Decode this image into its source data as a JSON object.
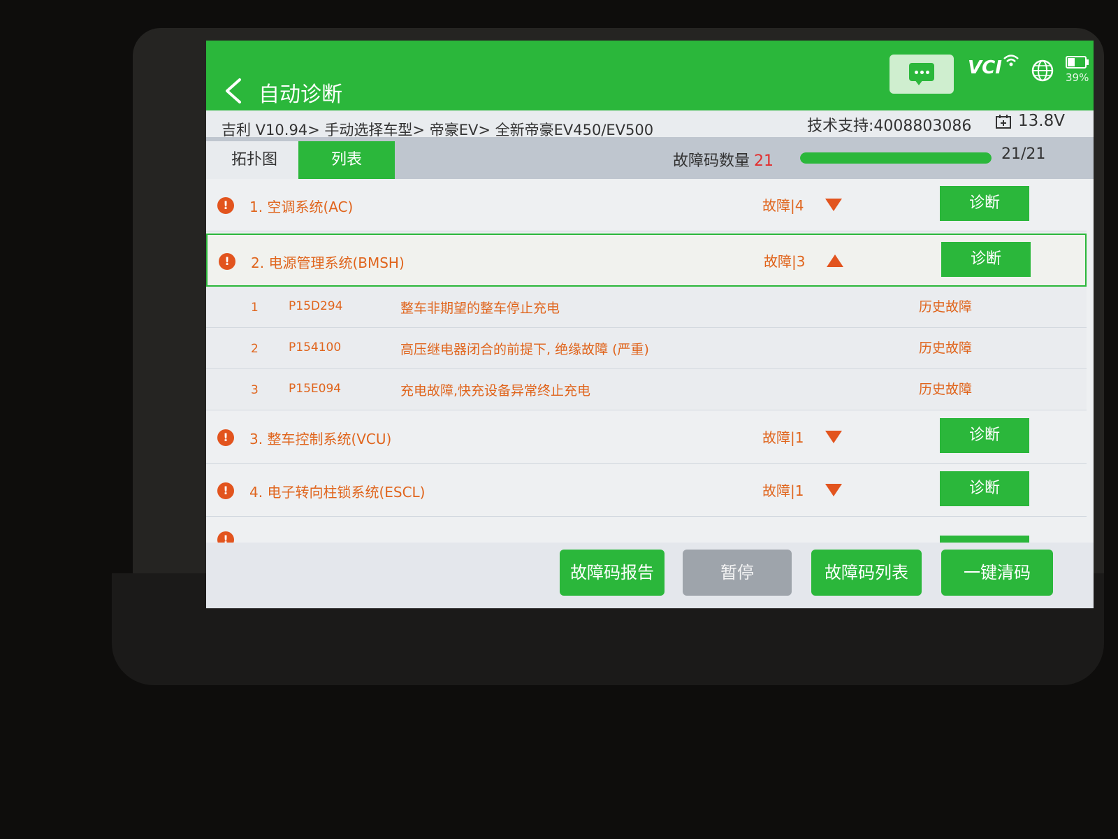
{
  "header": {
    "title": "自动诊断",
    "vci": "VCI",
    "battery": "39%",
    "colors": {
      "primary": "#2bb73b",
      "fault_text": "#e0651d",
      "count_red": "#e22e2e"
    },
    "icons": [
      "back-icon",
      "message-icon",
      "wifi-icon",
      "globe-icon",
      "battery-icon",
      "calendar-icon"
    ]
  },
  "info": {
    "breadcrumb": "吉利 V10.94> 手动选择车型> 帝豪EV> 全新帝豪EV450/EV500",
    "support": "技术支持:4008803086",
    "voltage": "13.8V"
  },
  "tabs": [
    {
      "label": "拓扑图",
      "active": false
    },
    {
      "label": "列表",
      "active": true
    }
  ],
  "summary": {
    "count_label": "故障码数量",
    "count": "21",
    "progress_text": "21/21",
    "progress_fraction": 1.0
  },
  "systems": [
    {
      "name": "1. 空调系统(AC)",
      "fault": "故障|4",
      "expanded": false,
      "button": "诊断"
    },
    {
      "name": "2. 电源管理系统(BMSH)",
      "fault": "故障|3",
      "expanded": true,
      "button": "诊断",
      "dtcs": [
        {
          "idx": "1",
          "code": "P15D294",
          "desc": "整车非期望的整车停止充电",
          "status": "历史故障"
        },
        {
          "idx": "2",
          "code": "P154100",
          "desc": "高压继电器闭合的前提下, 绝缘故障 (严重)",
          "status": "历史故障"
        },
        {
          "idx": "3",
          "code": "P15E094",
          "desc": "充电故障,快充设备异常终止充电",
          "status": "历史故障"
        }
      ]
    },
    {
      "name": "3. 整车控制系统(VCU)",
      "fault": "故障|1",
      "expanded": false,
      "button": "诊断"
    },
    {
      "name": "4. 电子转向柱锁系统(ESCL)",
      "fault": "故障|1",
      "expanded": false,
      "button": "诊断"
    }
  ],
  "actions": {
    "report": "故障码报告",
    "pause": "暂停",
    "dtc_list": "故障码列表",
    "clear": "一键清码"
  }
}
